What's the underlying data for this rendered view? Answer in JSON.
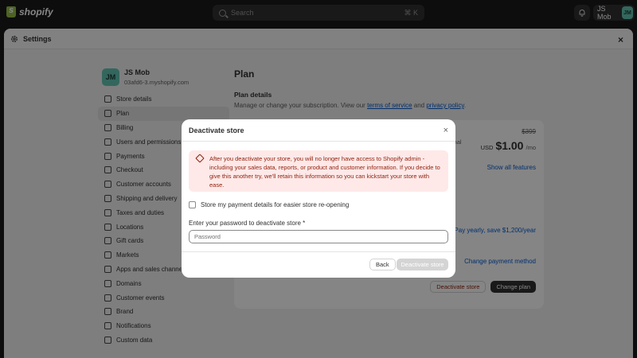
{
  "topbar": {
    "brand": "shopify",
    "search_placeholder": "Search",
    "search_shortcut": "⌘ K",
    "user_name": "JS Mob",
    "user_initials": "JM"
  },
  "settings": {
    "title": "Settings",
    "close": "×",
    "store": {
      "initials": "JM",
      "name": "JS Mob",
      "url": "03afd6-3.myshopify.com"
    },
    "nav": [
      {
        "label": "Store details",
        "icon": "store-icon"
      },
      {
        "label": "Plan",
        "icon": "plan-icon",
        "active": true
      },
      {
        "label": "Billing",
        "icon": "billing-icon"
      },
      {
        "label": "Users and permissions",
        "icon": "users-icon"
      },
      {
        "label": "Payments",
        "icon": "payments-icon"
      },
      {
        "label": "Checkout",
        "icon": "cart-icon"
      },
      {
        "label": "Customer accounts",
        "icon": "person-icon"
      },
      {
        "label": "Shipping and delivery",
        "icon": "truck-icon"
      },
      {
        "label": "Taxes and duties",
        "icon": "tax-icon"
      },
      {
        "label": "Locations",
        "icon": "location-icon"
      },
      {
        "label": "Gift cards",
        "icon": "gift-icon"
      },
      {
        "label": "Markets",
        "icon": "globe-icon"
      },
      {
        "label": "Apps and sales channels",
        "icon": "apps-icon"
      },
      {
        "label": "Domains",
        "icon": "globe-icon"
      },
      {
        "label": "Customer events",
        "icon": "events-icon"
      },
      {
        "label": "Brand",
        "icon": "brand-icon"
      },
      {
        "label": "Notifications",
        "icon": "bell-icon"
      },
      {
        "label": "Custom data",
        "icon": "data-icon"
      }
    ],
    "main": {
      "title": "Plan",
      "details_heading": "Plan details",
      "desc_prefix": "Manage or change your subscription. View our ",
      "terms_link": "terms of service",
      "desc_middle": " and ",
      "privacy_link": "privacy policy",
      "desc_suffix": ".",
      "card": {
        "partial_label": "sional",
        "old_price": "$399",
        "currency": "USD",
        "price": "$1.00",
        "period": "/mo",
        "show_all": "Show all features",
        "pay_yearly": "Pay yearly, save $1,200/year",
        "change_payment": "Change payment method",
        "deactivate_button": "Deactivate store",
        "change_plan_button": "Change plan"
      }
    }
  },
  "modal": {
    "title": "Deactivate store",
    "close": "×",
    "warning": "After you deactivate your store, you will no longer have access to Shopify admin - including your sales data, reports, or product and customer information. If you decide to give this another try, we'll retain this information so you can kickstart your store with ease.",
    "checkbox_label": "Store my payment details for easier store re-opening",
    "password_label": "Enter your password to deactivate store *",
    "password_placeholder": "Password",
    "password_value": "",
    "back_button": "Back",
    "deactivate_button": "Deactivate store"
  }
}
